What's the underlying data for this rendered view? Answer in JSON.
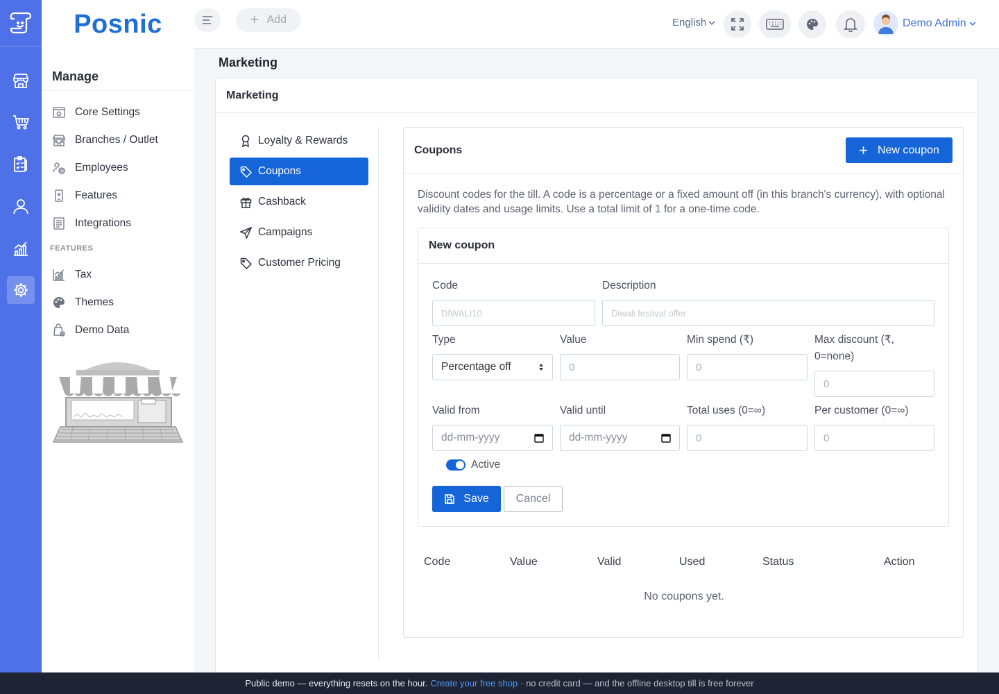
{
  "brand": {
    "name": "Posnic"
  },
  "topbar": {
    "add_label": "Add",
    "language": "English",
    "user_name": "Demo Admin"
  },
  "sidebar": {
    "heading": "Manage",
    "items": [
      {
        "label": "Core Settings",
        "icon": "settings-screen-icon"
      },
      {
        "label": "Branches / Outlet",
        "icon": "store-icon"
      },
      {
        "label": "Employees",
        "icon": "employees-gear-icon"
      },
      {
        "label": "Features",
        "icon": "phone-feature-icon"
      },
      {
        "label": "Integrations",
        "icon": "list-document-icon"
      }
    ],
    "features_heading": "FEATURES",
    "feature_items": [
      {
        "label": "Tax",
        "icon": "chart-tax-icon"
      },
      {
        "label": "Themes",
        "icon": "palette-icon"
      },
      {
        "label": "Demo Data",
        "icon": "bag-gear-icon"
      }
    ]
  },
  "page": {
    "title": "Marketing"
  },
  "card": {
    "title": "Marketing"
  },
  "tabs": [
    {
      "label": "Loyalty & Rewards",
      "icon": "award-icon"
    },
    {
      "label": "Coupons",
      "icon": "tag-icon",
      "active": true
    },
    {
      "label": "Cashback",
      "icon": "gift-icon"
    },
    {
      "label": "Campaigns",
      "icon": "send-icon"
    },
    {
      "label": "Customer Pricing",
      "icon": "tag-icon"
    }
  ],
  "coupons": {
    "title": "Coupons",
    "new_button": "New coupon",
    "description": "Discount codes for the till. A code is a percentage or a fixed amount off (in this branch's currency), with optional validity dates and usage limits. Use a total limit of 1 for a one-time code.",
    "form": {
      "title": "New coupon",
      "code_label": "Code",
      "code_placeholder": "DIWALI10",
      "description_label": "Description",
      "description_placeholder": "Diwali festival offer",
      "type_label": "Type",
      "type_value": "Percentage off",
      "value_label": "Value",
      "value_placeholder": "0",
      "min_spend_label": "Min spend (₹)",
      "min_spend_placeholder": "0",
      "max_discount_label_1": "Max discount (₹,",
      "max_discount_label_2": "0=none)",
      "max_discount_placeholder": "0",
      "valid_from_label": "Valid from",
      "valid_from_placeholder": "dd-mm-yyyy",
      "valid_until_label": "Valid until",
      "valid_until_placeholder": "dd-mm-yyyy",
      "total_uses_label": "Total uses (0=∞)",
      "total_uses_placeholder": "0",
      "per_customer_label": "Per customer (0=∞)",
      "per_customer_placeholder": "0",
      "active_label": "Active",
      "active": true,
      "save_label": "Save",
      "cancel_label": "Cancel"
    },
    "table": {
      "columns": [
        "Code",
        "Value",
        "Valid",
        "Used",
        "Status",
        "Action"
      ],
      "empty_text": "No coupons yet."
    }
  },
  "footer": {
    "text_before": "Public demo — everything resets on the hour.",
    "link": "Create your free shop",
    "text_after": "· no credit card — and the offline desktop till is free forever"
  },
  "colors": {
    "rail": "#4f71e8",
    "primary": "#1565d8",
    "brand": "#1f6fd6",
    "footer": "#1e2433"
  }
}
